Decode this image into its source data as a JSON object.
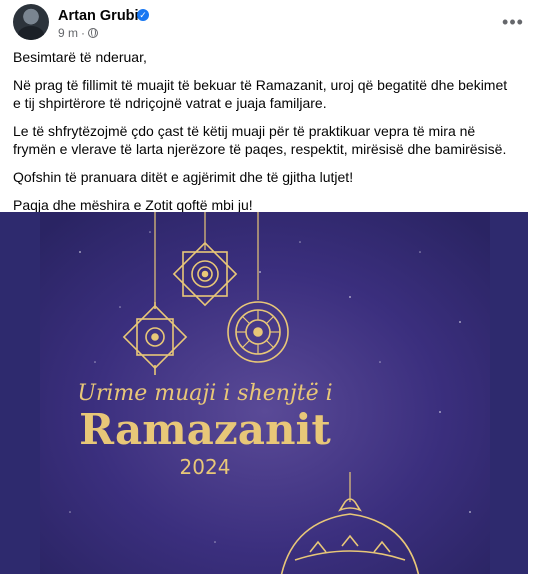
{
  "post": {
    "author": "Artan Grubi",
    "time": "9 m",
    "paragraphs": [
      "Besimtarë të nderuar,",
      "Në prag të fillimit të muajit të bekuar të Ramazanit, uroj që begatitë dhe bekimet e tij shpirtërore të ndriçojnë vatrat e juaja familjare.",
      "Le të shfrytëzojmë çdo çast të këtij muaji për të praktikuar vepra të mira në frymën e vlerave të larta njerëzore të paqes, respektit, mirësisë dhe bamirësisë.",
      "Qofshin të pranuara ditët e agjërimit dhe të gjitha lutjet!",
      "Paqja dhe mëshira e Zotit qoftë mbi ju!"
    ]
  },
  "image": {
    "line1": "Urime muaji i shenjtë i",
    "line2": "Ramazanit",
    "year": "2024",
    "colors": {
      "background": "#3a2f7d",
      "gold": "#e8c778"
    }
  },
  "icons": {
    "verified": "verified-badge-icon",
    "more": "more-options-icon",
    "privacy": "globe-icon"
  }
}
